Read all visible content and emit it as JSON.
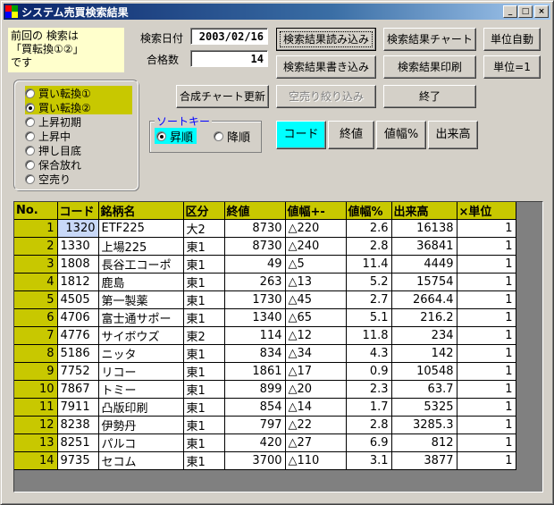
{
  "window": {
    "title": "システム売買検索結果",
    "controls": {
      "minimize": "_",
      "maximize": "□",
      "close": "×"
    }
  },
  "note": {
    "line1": "前回の 検索は",
    "line2": "「買転換①②」",
    "line3": "です"
  },
  "search": {
    "date_label": "検索日付",
    "date_value": "2003/02/16",
    "count_label": "合格数",
    "count_value": "14"
  },
  "buttons": {
    "load_results": "検索結果読み込み",
    "results_chart": "検索結果チャート",
    "unit_auto": "単位自動",
    "write_results": "検索結果書き込み",
    "print_results": "検索結果印刷",
    "unit_one": "単位=1",
    "update_chart": "合成チャート更新",
    "short_filter": "空売り絞り込み",
    "exit": "終了",
    "sort_code": "コード",
    "sort_close": "終値",
    "sort_change": "値幅%",
    "sort_volume": "出来高"
  },
  "strategies": [
    {
      "label": "買い転換①",
      "selected": false,
      "highlight": true
    },
    {
      "label": "買い転換②",
      "selected": true,
      "highlight": true
    },
    {
      "label": "上昇初期",
      "selected": false,
      "highlight": false
    },
    {
      "label": "上昇中",
      "selected": false,
      "highlight": false
    },
    {
      "label": "押し目底",
      "selected": false,
      "highlight": false
    },
    {
      "label": "保合放れ",
      "selected": false,
      "highlight": false
    },
    {
      "label": "空売り",
      "selected": false,
      "highlight": false
    }
  ],
  "sort": {
    "legend": "ソートキー",
    "asc": "昇順",
    "desc": "降順",
    "selected": "asc"
  },
  "table": {
    "headers": [
      "No.",
      "コード",
      "銘柄名",
      "区分",
      "終値",
      "値幅+-",
      "値幅%",
      "出来高",
      "×単位"
    ],
    "rows": [
      [
        "1",
        "1320",
        "ETF225",
        "大2",
        "8730",
        "△220",
        "2.6",
        "16138",
        "1"
      ],
      [
        "2",
        "1330",
        "上場225",
        "東1",
        "8730",
        "△240",
        "2.8",
        "36841",
        "1"
      ],
      [
        "3",
        "1808",
        "長谷工コーポ",
        "東1",
        "49",
        "△5",
        "11.4",
        "4449",
        "1"
      ],
      [
        "4",
        "1812",
        "鹿島",
        "東1",
        "263",
        "△13",
        "5.2",
        "15754",
        "1"
      ],
      [
        "5",
        "4505",
        "第一製薬",
        "東1",
        "1730",
        "△45",
        "2.7",
        "2664.4",
        "1"
      ],
      [
        "6",
        "4706",
        "富士通サポー",
        "東1",
        "1340",
        "△65",
        "5.1",
        "216.2",
        "1"
      ],
      [
        "7",
        "4776",
        "サイボウズ",
        "東2",
        "114",
        "△12",
        "11.8",
        "234",
        "1"
      ],
      [
        "8",
        "5186",
        "ニッタ",
        "東1",
        "834",
        "△34",
        "4.3",
        "142",
        "1"
      ],
      [
        "9",
        "7752",
        "リコー",
        "東1",
        "1861",
        "△17",
        "0.9",
        "10548",
        "1"
      ],
      [
        "10",
        "7867",
        "トミー",
        "東1",
        "899",
        "△20",
        "2.3",
        "63.7",
        "1"
      ],
      [
        "11",
        "7911",
        "凸版印刷",
        "東1",
        "854",
        "△14",
        "1.7",
        "5325",
        "1"
      ],
      [
        "12",
        "8238",
        "伊勢丹",
        "東1",
        "797",
        "△22",
        "2.8",
        "3285.3",
        "1"
      ],
      [
        "13",
        "8251",
        "パルコ",
        "東1",
        "420",
        "△27",
        "6.9",
        "812",
        "1"
      ],
      [
        "14",
        "9735",
        "セコム",
        "東1",
        "3700",
        "△110",
        "3.1",
        "3877",
        "1"
      ]
    ]
  },
  "colors": {
    "highlight": "#c8c800",
    "active_sort": "#00ffff",
    "note_bg": "#ffffcc",
    "selected_cell": "#c8d8f8"
  }
}
